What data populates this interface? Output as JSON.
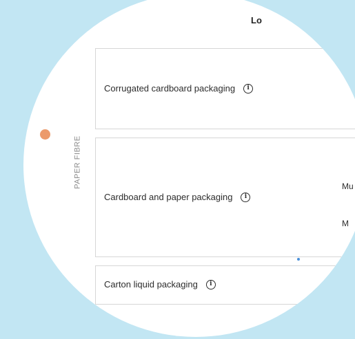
{
  "category": {
    "label": "PAPER FIBRE",
    "color": "#ec9a6b"
  },
  "table": {
    "column_header_fragment": "Lo",
    "rows": [
      {
        "label": "Corrugated cardboard packaging",
        "icon": "info-icon"
      },
      {
        "label": "Cardboard and paper packaging",
        "icon": "info-icon",
        "sub_options_fragments": [
          "Mu",
          "M"
        ]
      },
      {
        "label": "Carton liquid packaging",
        "icon": "info-icon"
      }
    ]
  },
  "colors": {
    "background": "#c2e6f3",
    "panel": "#ffffff",
    "border": "#d6d6d6",
    "text": "#2c2c2c"
  }
}
